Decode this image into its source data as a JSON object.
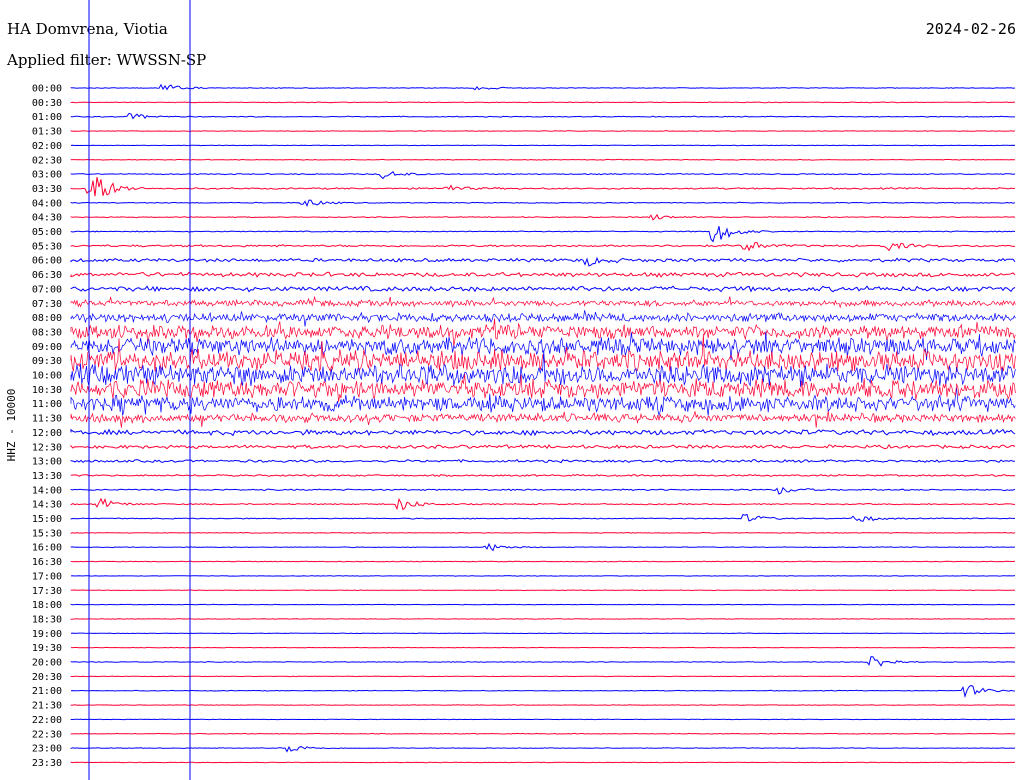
{
  "header": {
    "station": "HA Domvrena, Viotia",
    "filter": "Applied filter: WWSSN-SP",
    "date": "2024-02-26"
  },
  "colors": {
    "even_hour_trace": "#0000ff",
    "half_hour_trace": "#ff0033",
    "marker_line": "#0000ff"
  },
  "chart_data": {
    "type": "line",
    "subtype": "helicorder",
    "y_axis_label": "HHZ - 10000",
    "time_labels": [
      "00:00",
      "00:30",
      "01:00",
      "01:30",
      "02:00",
      "02:30",
      "03:00",
      "03:30",
      "04:00",
      "04:30",
      "05:00",
      "05:30",
      "06:00",
      "06:30",
      "07:00",
      "07:30",
      "08:00",
      "08:30",
      "09:00",
      "09:30",
      "10:00",
      "10:30",
      "11:00",
      "11:30",
      "12:00",
      "12:30",
      "13:00",
      "13:30",
      "14:00",
      "14:30",
      "15:00",
      "15:30",
      "16:00",
      "16:30",
      "17:00",
      "17:30",
      "18:00",
      "18:30",
      "19:00",
      "19:30",
      "20:00",
      "20:30",
      "21:00",
      "21:30",
      "22:00",
      "22:30",
      "23:00",
      "23:30"
    ],
    "minutes_per_line": 30,
    "trace_colors_alternate": [
      "blue",
      "red"
    ],
    "activity": [
      0.4,
      0.4,
      0.5,
      0.3,
      0.3,
      0.4,
      0.6,
      0.9,
      0.5,
      0.5,
      0.6,
      1.2,
      2.0,
      2.5,
      3.0,
      3.5,
      5.0,
      8.0,
      10.0,
      12.0,
      12.0,
      11.0,
      9.0,
      5.0,
      3.0,
      2.0,
      1.5,
      1.0,
      0.8,
      0.7,
      0.6,
      0.4,
      0.4,
      0.4,
      0.3,
      0.3,
      0.3,
      0.3,
      0.3,
      0.3,
      0.4,
      0.3,
      0.4,
      0.3,
      0.3,
      0.4,
      0.4,
      0.3
    ],
    "events": [
      {
        "line": 0,
        "minute": 3,
        "amp": 4
      },
      {
        "line": 0,
        "minute": 13,
        "amp": 2
      },
      {
        "line": 2,
        "minute": 2,
        "amp": 3
      },
      {
        "line": 6,
        "minute": 10,
        "amp": 4
      },
      {
        "line": 7,
        "minute": 0.7,
        "amp": 20
      },
      {
        "line": 7,
        "minute": 12,
        "amp": 3
      },
      {
        "line": 8,
        "minute": 7.5,
        "amp": 4
      },
      {
        "line": 9,
        "minute": 18.5,
        "amp": 3
      },
      {
        "line": 10,
        "minute": 20.5,
        "amp": 12
      },
      {
        "line": 11,
        "minute": 21.5,
        "amp": 5
      },
      {
        "line": 11,
        "minute": 26,
        "amp": 4
      },
      {
        "line": 12,
        "minute": 16.5,
        "amp": 4
      },
      {
        "line": 28,
        "minute": 22.5,
        "amp": 4
      },
      {
        "line": 29,
        "minute": 1,
        "amp": 5
      },
      {
        "line": 29,
        "minute": 10.5,
        "amp": 6
      },
      {
        "line": 30,
        "minute": 21.5,
        "amp": 4
      },
      {
        "line": 30,
        "minute": 25,
        "amp": 4
      },
      {
        "line": 32,
        "minute": 13.3,
        "amp": 4
      },
      {
        "line": 40,
        "minute": 25.5,
        "amp": 7
      },
      {
        "line": 42,
        "minute": 28.5,
        "amp": 6
      },
      {
        "line": 46,
        "minute": 7,
        "amp": 4
      }
    ],
    "grid": false,
    "legend": "none"
  }
}
